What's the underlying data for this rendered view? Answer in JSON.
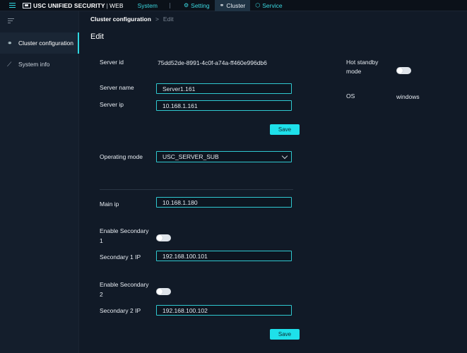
{
  "topbar": {
    "logo_text": "USC UNIFIED SECURITY",
    "logo_separator": "|",
    "logo_suffix": "WEB",
    "nav": {
      "system": "System",
      "setting": "Setting",
      "cluster": "Cluster",
      "service": "Service"
    }
  },
  "sidebar": {
    "items": [
      {
        "label": "Cluster configuration",
        "icon": "cluster-icon",
        "active": true
      },
      {
        "label": "System info",
        "icon": "chart-icon",
        "active": false
      }
    ]
  },
  "breadcrumb": {
    "root": "Cluster configuration",
    "separator": ">",
    "current": "Edit"
  },
  "page": {
    "title": "Edit"
  },
  "form": {
    "server_id_label": "Server id",
    "server_id_value": "75dd52de-8991-4c0f-a74a-ff460e996db6",
    "server_name_label": "Server name",
    "server_name_value": "Server1.161",
    "server_ip_label": "Server ip",
    "server_ip_value": "10.168.1.161",
    "save_label_1": "Save",
    "operating_mode_label": "Operating mode",
    "operating_mode_value": "USC_SERVER_SUB",
    "main_ip_label": "Main ip",
    "main_ip_value": "10.168.1.180",
    "enable_secondary1_label_a": "Enable Secondary",
    "enable_secondary1_label_b": "1",
    "secondary1_ip_label": "Secondary 1 IP",
    "secondary1_ip_value": "192.168.100.101",
    "enable_secondary2_label_a": "Enable Secondary",
    "enable_secondary2_label_b": "2",
    "secondary2_ip_label": "Secondary 2 IP",
    "secondary2_ip_value": "192.168.100.102",
    "save_label_2": "Save",
    "hot_standby_label_a": "Hot standby",
    "hot_standby_label_b": "mode",
    "os_label": "OS",
    "os_value": "windows"
  },
  "colors": {
    "accent": "#1ee0ea",
    "background": "#111a27",
    "topbar": "#0b1119",
    "sidebar": "#141e2c"
  }
}
